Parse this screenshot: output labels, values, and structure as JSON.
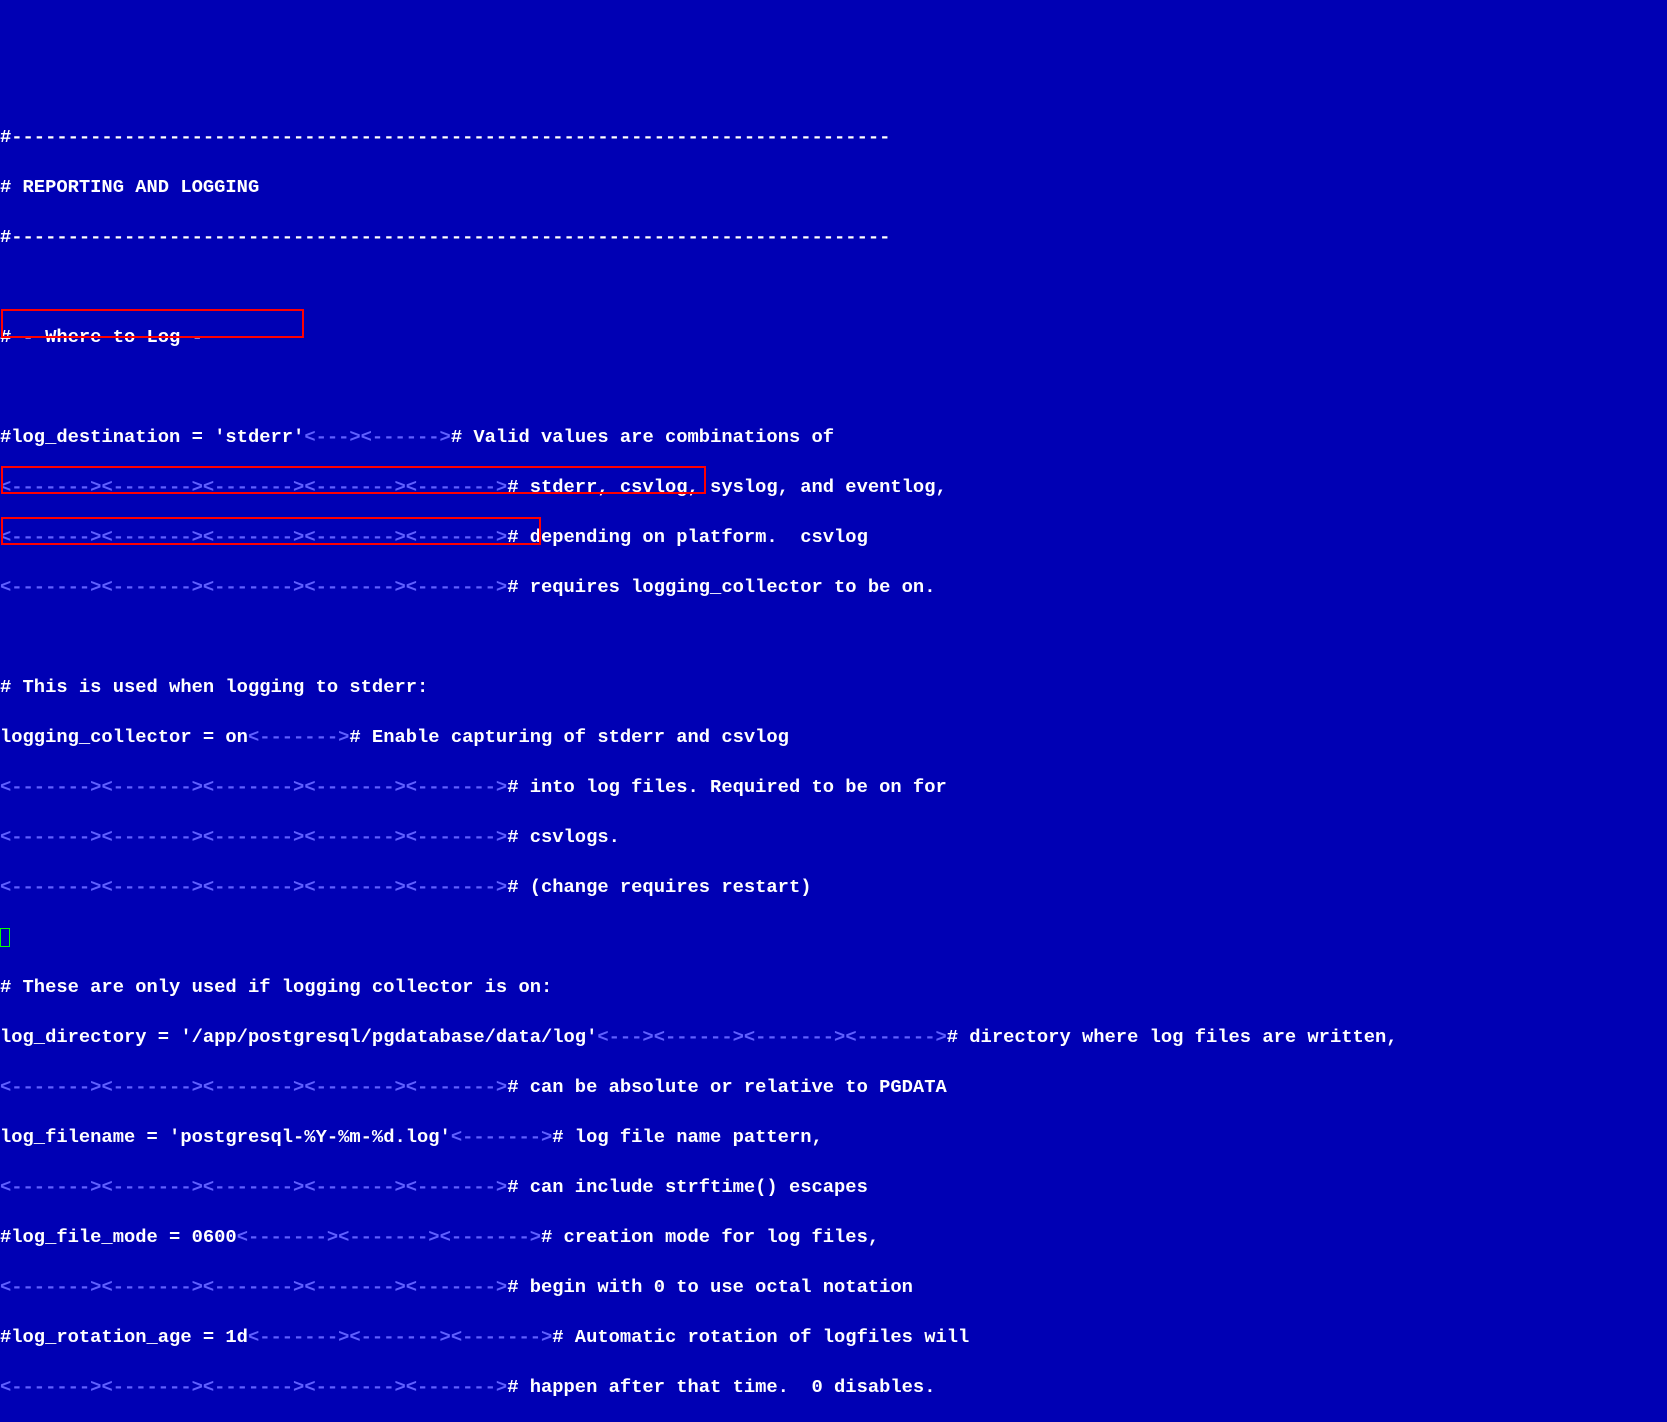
{
  "tab": "<------->",
  "tabs": "<---><------>",
  "lines": {
    "sep": "#------------------------------------------------------------------------------",
    "heading": "# REPORTING AND LOGGING",
    "where": "# - Where to Log -",
    "logdest": "#log_destination = 'stderr'",
    "c_valid": "# Valid values are combinations of",
    "c_stderr": "# stderr, csvlog, syslog, and eventlog,",
    "c_depend": "# depending on platform.  csvlog",
    "c_req": "# requires logging_collector to be on.",
    "this_used": "# This is used when logging to stderr:",
    "logcol": "logging_collector = on",
    "c_enable": "# Enable capturing of stderr and csvlog",
    "c_into": "# into log files. Required to be on for",
    "c_csv": "# csvlogs.",
    "c_change": "# (change requires restart)",
    "these_only": "# These are only used if logging collector is on:",
    "logdir": "log_directory = '/app/postgresql/pgdatabase/data/log'",
    "c_dirwhere": "# directory where log files are written,",
    "c_abs": "# can be absolute or relative to PGDATA",
    "logfn": "log_filename = 'postgresql-%Y-%m-%d.log'",
    "c_pattern": "# log file name pattern,",
    "c_strftime": "# can include strftime() escapes",
    "logmode": "#log_file_mode = 0600",
    "c_creation": "# creation mode for log files,",
    "c_begin": "# begin with 0 to use octal notation",
    "logrot": "#log_rotation_age = 1d",
    "c_auto": "# Automatic rotation of logfiles will",
    "c_happen": "# happen after that time.  0 disables."
  },
  "highlights": [
    "logging-collector-setting",
    "log-directory-setting",
    "log-filename-setting"
  ]
}
